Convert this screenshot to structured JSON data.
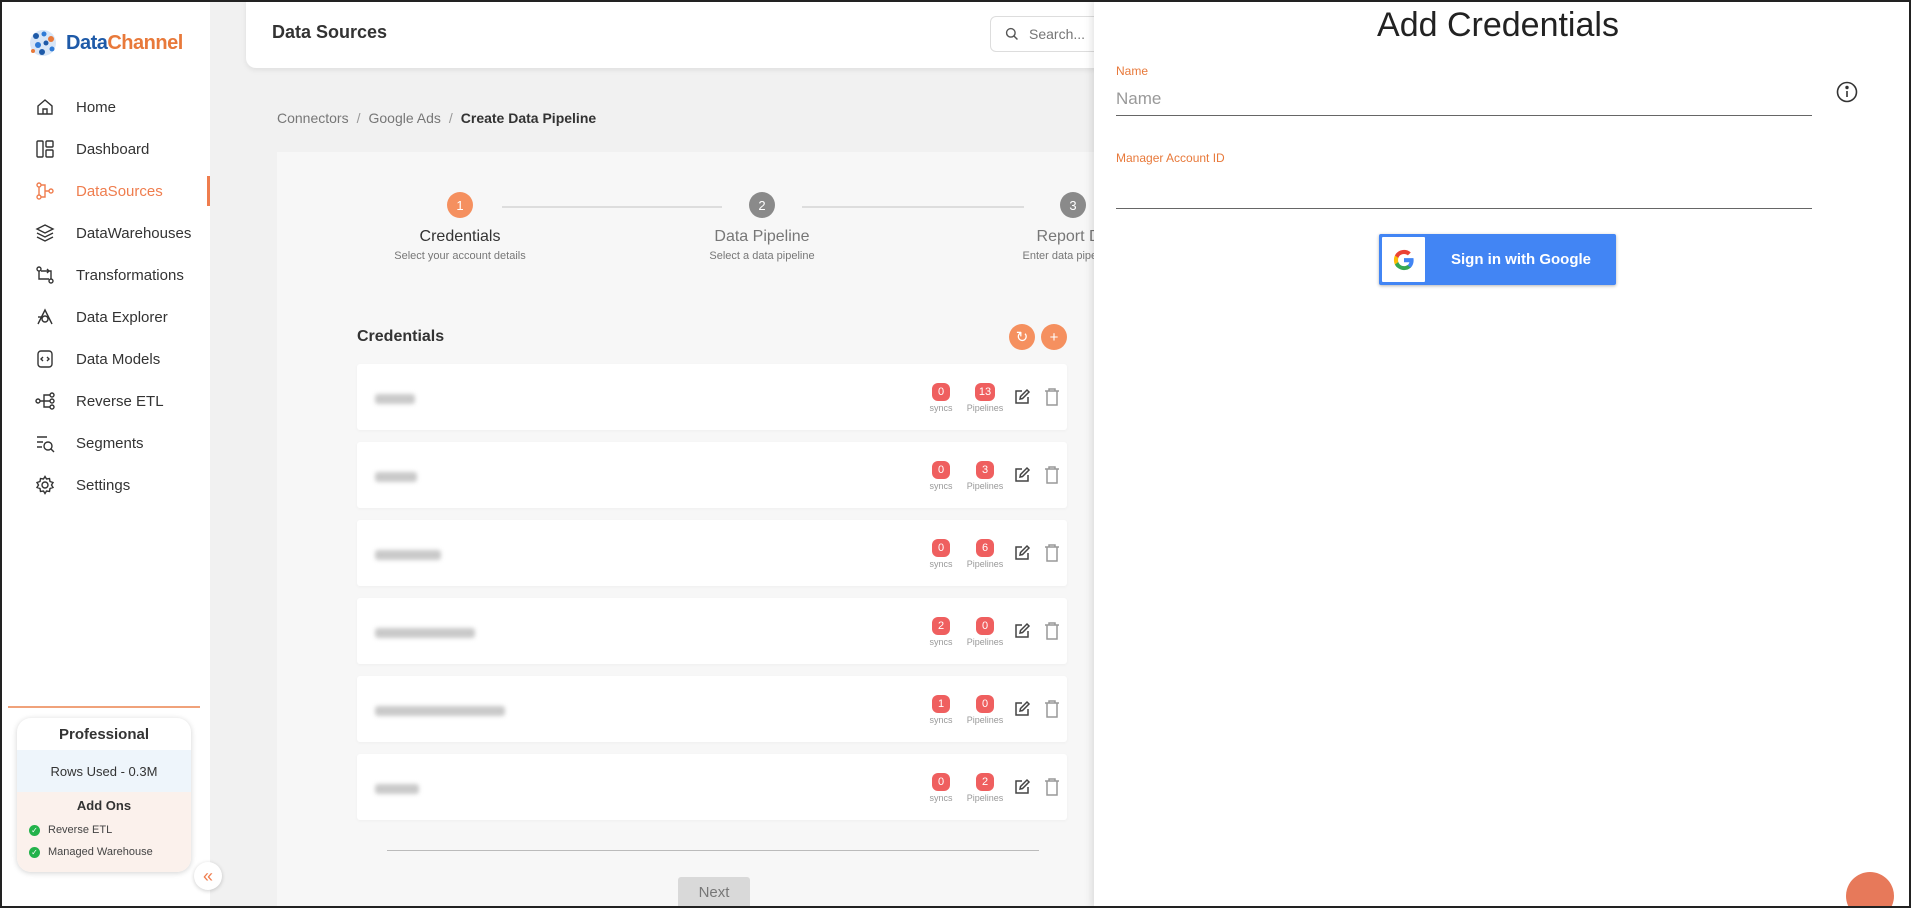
{
  "brand": {
    "name_part1": "Data",
    "name_part2": "Channel"
  },
  "sidebar": {
    "items": [
      {
        "label": "Home",
        "icon": "home-icon",
        "active": false
      },
      {
        "label": "Dashboard",
        "icon": "dashboard-icon",
        "active": false
      },
      {
        "label": "DataSources",
        "icon": "datasources-icon",
        "active": true
      },
      {
        "label": "DataWarehouses",
        "icon": "layers-icon",
        "active": false
      },
      {
        "label": "Transformations",
        "icon": "transform-icon",
        "active": false
      },
      {
        "label": "Data Explorer",
        "icon": "explorer-icon",
        "active": false
      },
      {
        "label": "Data Models",
        "icon": "model-icon",
        "active": false
      },
      {
        "label": "Reverse ETL",
        "icon": "reverse-etl-icon",
        "active": false
      },
      {
        "label": "Segments",
        "icon": "segments-icon",
        "active": false
      },
      {
        "label": "Settings",
        "icon": "gear-icon",
        "active": false
      }
    ],
    "plan": {
      "title": "Professional",
      "rows_used": "Rows Used - 0.3M",
      "addons_title": "Add Ons",
      "addons": [
        "Reverse ETL",
        "Managed Warehouse"
      ]
    }
  },
  "header": {
    "title": "Data Sources",
    "search_placeholder": "Search..."
  },
  "breadcrumb": {
    "items": [
      "Connectors",
      "Google Ads",
      "Create Data Pipeline"
    ],
    "separator": "/"
  },
  "stepper": {
    "steps": [
      {
        "number": "1",
        "title": "Credentials",
        "subtitle": "Select your account details"
      },
      {
        "number": "2",
        "title": "Data Pipeline",
        "subtitle": "Select a data pipeline"
      },
      {
        "number": "3",
        "title": "Report De",
        "subtitle": "Enter data pipeline d"
      }
    ]
  },
  "credentials": {
    "title": "Credentials",
    "syncs_label": "syncs",
    "pipelines_label": "Pipelines",
    "rows": [
      {
        "syncs": "0",
        "pipelines": "13"
      },
      {
        "syncs": "0",
        "pipelines": "3"
      },
      {
        "syncs": "0",
        "pipelines": "6"
      },
      {
        "syncs": "2",
        "pipelines": "0"
      },
      {
        "syncs": "1",
        "pipelines": "0"
      },
      {
        "syncs": "0",
        "pipelines": "2"
      }
    ],
    "next_label": "Next"
  },
  "drawer": {
    "title": "Add Credentials",
    "name_label": "Name",
    "name_placeholder": "Name",
    "manager_label": "Manager Account ID",
    "manager_value": "",
    "google_button": "Sign in with Google"
  },
  "colors": {
    "accent": "#ef7d4e",
    "badge": "#ef5f5f",
    "google_blue": "#4285f4",
    "brand_blue": "#1e5aa8"
  }
}
